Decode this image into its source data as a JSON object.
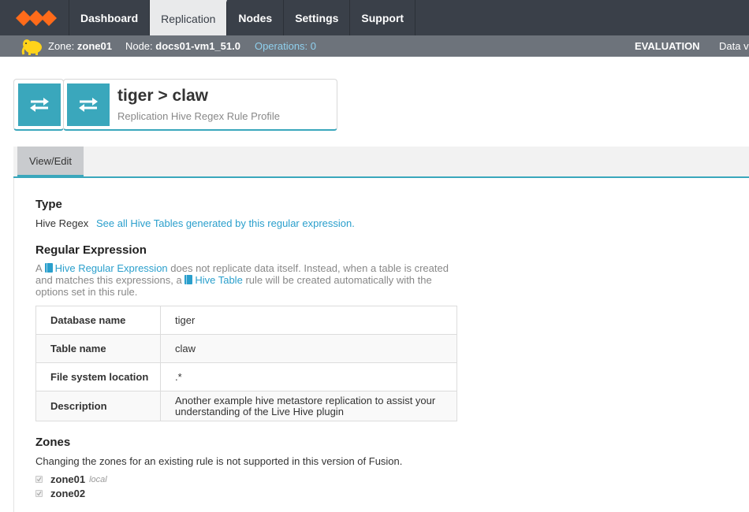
{
  "nav": {
    "items": [
      {
        "label": "Dashboard",
        "active": false
      },
      {
        "label": "Replication",
        "active": true
      },
      {
        "label": "Nodes",
        "active": false
      },
      {
        "label": "Settings",
        "active": false
      },
      {
        "label": "Support",
        "active": false
      }
    ],
    "logo_icon": "wandisco-logo-icon",
    "accent_color": "#ff6b1a"
  },
  "status": {
    "zone_label": "Zone:",
    "zone_value": "zone01",
    "node_label": "Node:",
    "node_value": "docs01-vm1_51.0",
    "operations": "Operations: 0",
    "license": "EVALUATION",
    "data_truncated": "Data vo"
  },
  "header": {
    "title": "tiger > claw",
    "subtitle": "Replication Hive Regex Rule Profile",
    "icon": "replication-arrows-icon",
    "tile_color": "#3aa7bc"
  },
  "tabs": [
    {
      "label": "View/Edit",
      "active": true
    }
  ],
  "type_section": {
    "heading": "Type",
    "value": "Hive Regex",
    "link": "See all Hive Tables generated by this regular expression."
  },
  "regex_section": {
    "heading": "Regular Expression",
    "desc_prefix": "A",
    "desc_link1": "Hive Regular Expression",
    "desc_middle": "does not replicate data itself. Instead, when a table is created and matches this expressions, a",
    "desc_link2": "Hive Table",
    "desc_suffix": "rule will be created automatically with the options set in this rule."
  },
  "properties": [
    {
      "key": "Database name",
      "value": "tiger"
    },
    {
      "key": "Table name",
      "value": "claw"
    },
    {
      "key": "File system location",
      "value": ".*"
    },
    {
      "key": "Description",
      "value": "Another example hive metastore replication to assist your understanding of the Live Hive plugin"
    }
  ],
  "zones_section": {
    "heading": "Zones",
    "note": "Changing the zones for an existing rule is not supported in this version of Fusion.",
    "zones": [
      {
        "name": "zone01",
        "tag": "local",
        "checked": true
      },
      {
        "name": "zone02",
        "tag": "",
        "checked": true
      }
    ]
  }
}
